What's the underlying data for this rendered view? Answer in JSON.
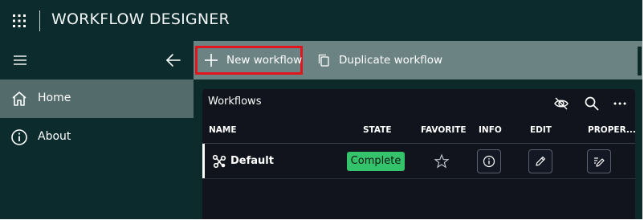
{
  "app": {
    "title": "WORKFLOW DESIGNER"
  },
  "sidebar": {
    "items": [
      {
        "label": "Home",
        "icon": "home-icon",
        "active": true
      },
      {
        "label": "About",
        "icon": "info-icon",
        "active": false
      }
    ]
  },
  "toolbar": {
    "new_label": "New workflow",
    "duplicate_label": "Duplicate workflow"
  },
  "panel": {
    "title": "Workflows",
    "columns": [
      "NAME",
      "STATE",
      "FAVORITE",
      "INFO",
      "EDIT",
      "PROPER..."
    ],
    "rows": [
      {
        "name": "Default",
        "state": "Complete",
        "favorite": false
      }
    ]
  },
  "colors": {
    "topbar": "#0b2b2c",
    "toolbar": "#6c8383",
    "active_nav": "#546b6b",
    "panel": "#11141c",
    "state_complete": "#34c26b",
    "highlight": "#e0161c"
  }
}
